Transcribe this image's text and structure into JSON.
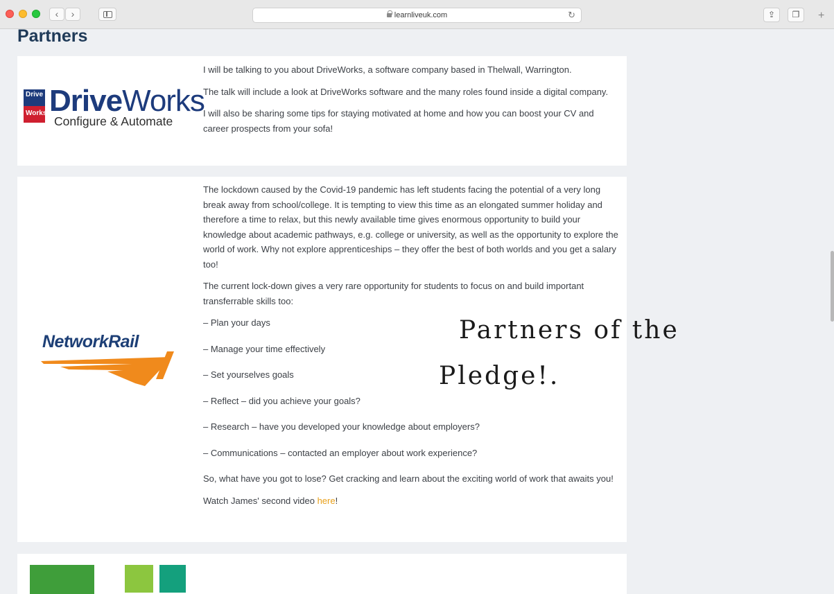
{
  "browser": {
    "url": "learnliveuk.com"
  },
  "page": {
    "title": "Partners"
  },
  "driveworks": {
    "logo_badge_top": "Drive",
    "logo_badge_bottom": "Works",
    "logo_name_bold": "Drive",
    "logo_name_rest": "Works",
    "logo_tagline": "Configure & Automate",
    "paragraphs": [
      "I will be talking to you about DriveWorks, a software company based in Thelwall, Warrington.",
      "The talk will include a look at DriveWorks software and the many roles found inside a digital company.",
      "I will also be sharing some tips for staying motivated at home and how you can boost your CV and career prospects from your sofa!"
    ]
  },
  "networkrail": {
    "logo_text": "NetworkRail",
    "intro": "The lockdown caused by the Covid-19 pandemic has left students facing the potential of a very long break away from school/college.  It is tempting to view this time as an elongated summer holiday and therefore a time to relax, but this newly available time gives enormous opportunity to build your knowledge about academic pathways, e.g. college or university, as well as the opportunity to explore the world of work.  Why not explore apprenticeships – they offer the best of both worlds and you get a salary too!",
    "skills_intro": "The current lock-down gives a very rare opportunity for students to focus on and build important transferrable skills too:",
    "skills": [
      "– Plan your days",
      "– Manage your time effectively",
      "– Set yourselves goals",
      "– Reflect – did you achieve your goals?",
      "– Research – have you developed your knowledge about employers?",
      "– Communications – contacted an employer about work experience?"
    ],
    "closing": "So, what have you got to lose?  Get cracking and learn about the exciting world of work that awaits you!",
    "video_prefix": "Watch James' second video ",
    "video_link": "here",
    "video_suffix": "!"
  },
  "annotation": {
    "line1": "Partners of the",
    "line2": "Pledge!."
  },
  "colors": {
    "title": "#1f3a58",
    "link": "#e8a01a",
    "nr_blue": "#1d3f76",
    "nr_orange": "#f08a1c"
  }
}
